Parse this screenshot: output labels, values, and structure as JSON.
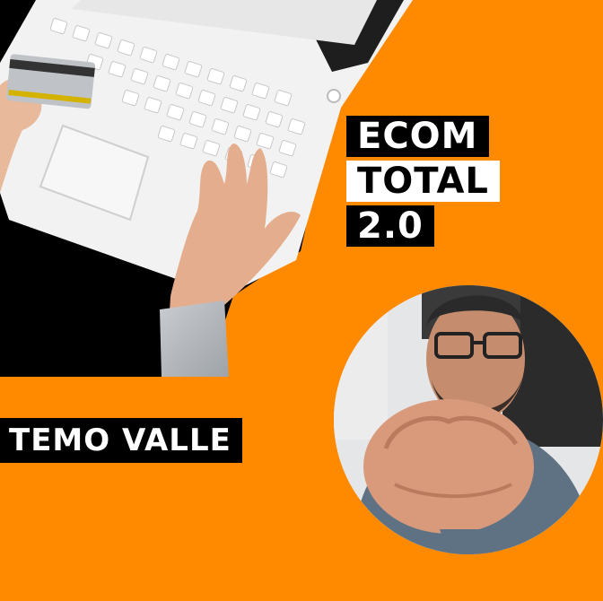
{
  "banner": {
    "title_lines": [
      "ECOM",
      "TOTAL",
      "2.0"
    ],
    "presenter_name": "TEMO VALLE"
  },
  "colors": {
    "background": "#FF8A00",
    "panel": "#000000",
    "text_light": "#FFFFFF"
  },
  "photos": {
    "laptop_photo": "laptop-shopping-photo",
    "presenter_photo": "presenter-portrait-photo"
  }
}
